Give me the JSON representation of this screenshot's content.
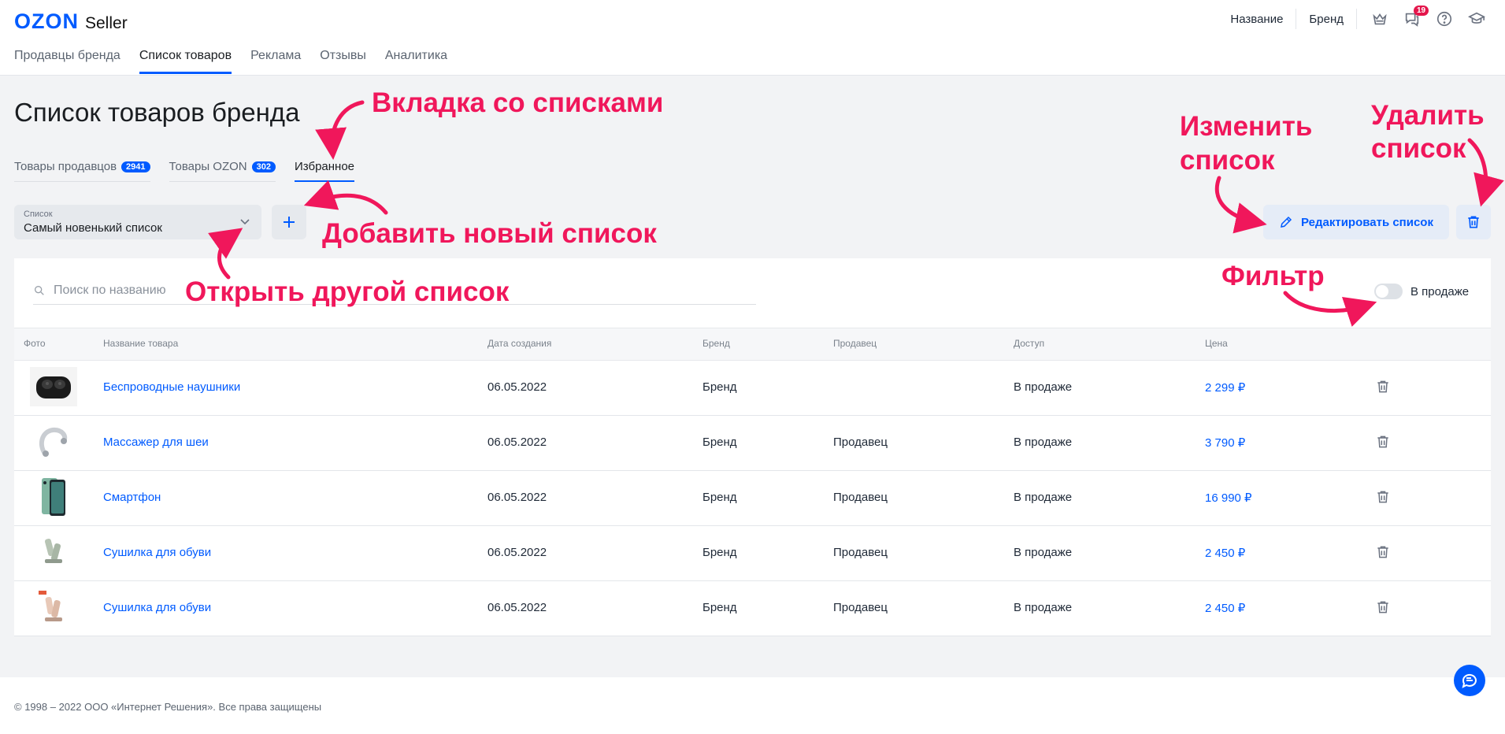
{
  "header": {
    "logo_brand": "OZON",
    "logo_product": "Seller",
    "nav": [
      {
        "label": "Продавцы бренда"
      },
      {
        "label": "Список товаров"
      },
      {
        "label": "Реклама"
      },
      {
        "label": "Отзывы"
      },
      {
        "label": "Аналитика"
      }
    ],
    "right_links": [
      "Название",
      "Бренд"
    ],
    "icons": [
      "crown-icon",
      "chat-bubbles-icon",
      "help-icon",
      "graduation-cap-icon"
    ],
    "notifications_count": "19"
  },
  "page": {
    "title": "Список товаров бренда",
    "tabs": [
      {
        "label": "Товары продавцов",
        "count": "2941"
      },
      {
        "label": "Товары OZON",
        "count": "302"
      },
      {
        "label": "Избранное"
      }
    ]
  },
  "list_select": {
    "label": "Список",
    "value": "Самый новенький список"
  },
  "buttons": {
    "edit_list": "Редактировать список"
  },
  "filters": {
    "search_placeholder": "Поиск по названию",
    "on_sale_label": "В продаже"
  },
  "table": {
    "columns": [
      "Фото",
      "Название товара",
      "Дата создания",
      "Бренд",
      "Продавец",
      "Доступ",
      "Цена"
    ],
    "rows": [
      {
        "name": "Беспроводные наушники",
        "date": "06.05.2022",
        "brand": "Бренд",
        "seller": "",
        "access": "В продаже",
        "price": "2 299 ₽",
        "photo": "earbuds"
      },
      {
        "name": "Массажер для шеи",
        "date": "06.05.2022",
        "brand": "Бренд",
        "seller": "Продавец",
        "access": "В продаже",
        "price": "3 790 ₽",
        "photo": "neck-massager"
      },
      {
        "name": "Смартфон",
        "date": "06.05.2022",
        "brand": "Бренд",
        "seller": "Продавец",
        "access": "В продаже",
        "price": "16 990 ₽",
        "photo": "smartphone"
      },
      {
        "name": "Сушилка для обуви",
        "date": "06.05.2022",
        "brand": "Бренд",
        "seller": "Продавец",
        "access": "В продаже",
        "price": "2 450 ₽",
        "photo": "shoe-dryer"
      },
      {
        "name": "Сушилка для обуви",
        "date": "06.05.2022",
        "brand": "Бренд",
        "seller": "Продавец",
        "access": "В продаже",
        "price": "2 450 ₽",
        "photo": "shoe-dryer-2"
      }
    ]
  },
  "footer": {
    "copyright": "© 1998 – 2022 ООО «Интернет Решения». Все права защищены"
  },
  "annotations": {
    "tabs_hint": "Вкладка со списками",
    "add_hint": "Добавить новый список",
    "open_hint": "Открыть другой список",
    "edit_hint_1": "Изменить",
    "edit_hint_2": "список",
    "delete_hint_1": "Удалить",
    "delete_hint_2": "список",
    "filter_hint": "Фильтр",
    "color": "#f0175b"
  },
  "colors": {
    "accent": "#005bff",
    "badge": "#e4154b"
  }
}
